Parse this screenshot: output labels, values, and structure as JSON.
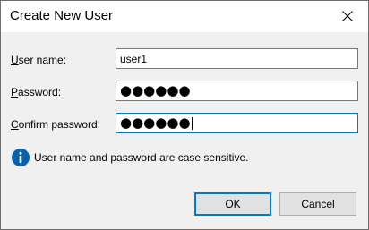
{
  "window": {
    "title": "Create New User",
    "close_icon": "close-icon"
  },
  "form": {
    "username": {
      "label_accel": "U",
      "label_rest": "ser name:",
      "value": "user1"
    },
    "password": {
      "label_accel": "P",
      "label_rest": "assword:",
      "value": "●●●●●●"
    },
    "confirm_password": {
      "label_accel": "C",
      "label_rest": "onfirm password:",
      "value": "●●●●●●"
    }
  },
  "info": {
    "icon": "info-icon",
    "text": "User name and password are case sensitive.",
    "color": "#0063b1"
  },
  "buttons": {
    "ok_label": "OK",
    "cancel_label": "Cancel"
  },
  "colors": {
    "client_bg": "#f0f0f0",
    "focus_border": "#0078d7",
    "button_bg": "#e1e1e1"
  }
}
